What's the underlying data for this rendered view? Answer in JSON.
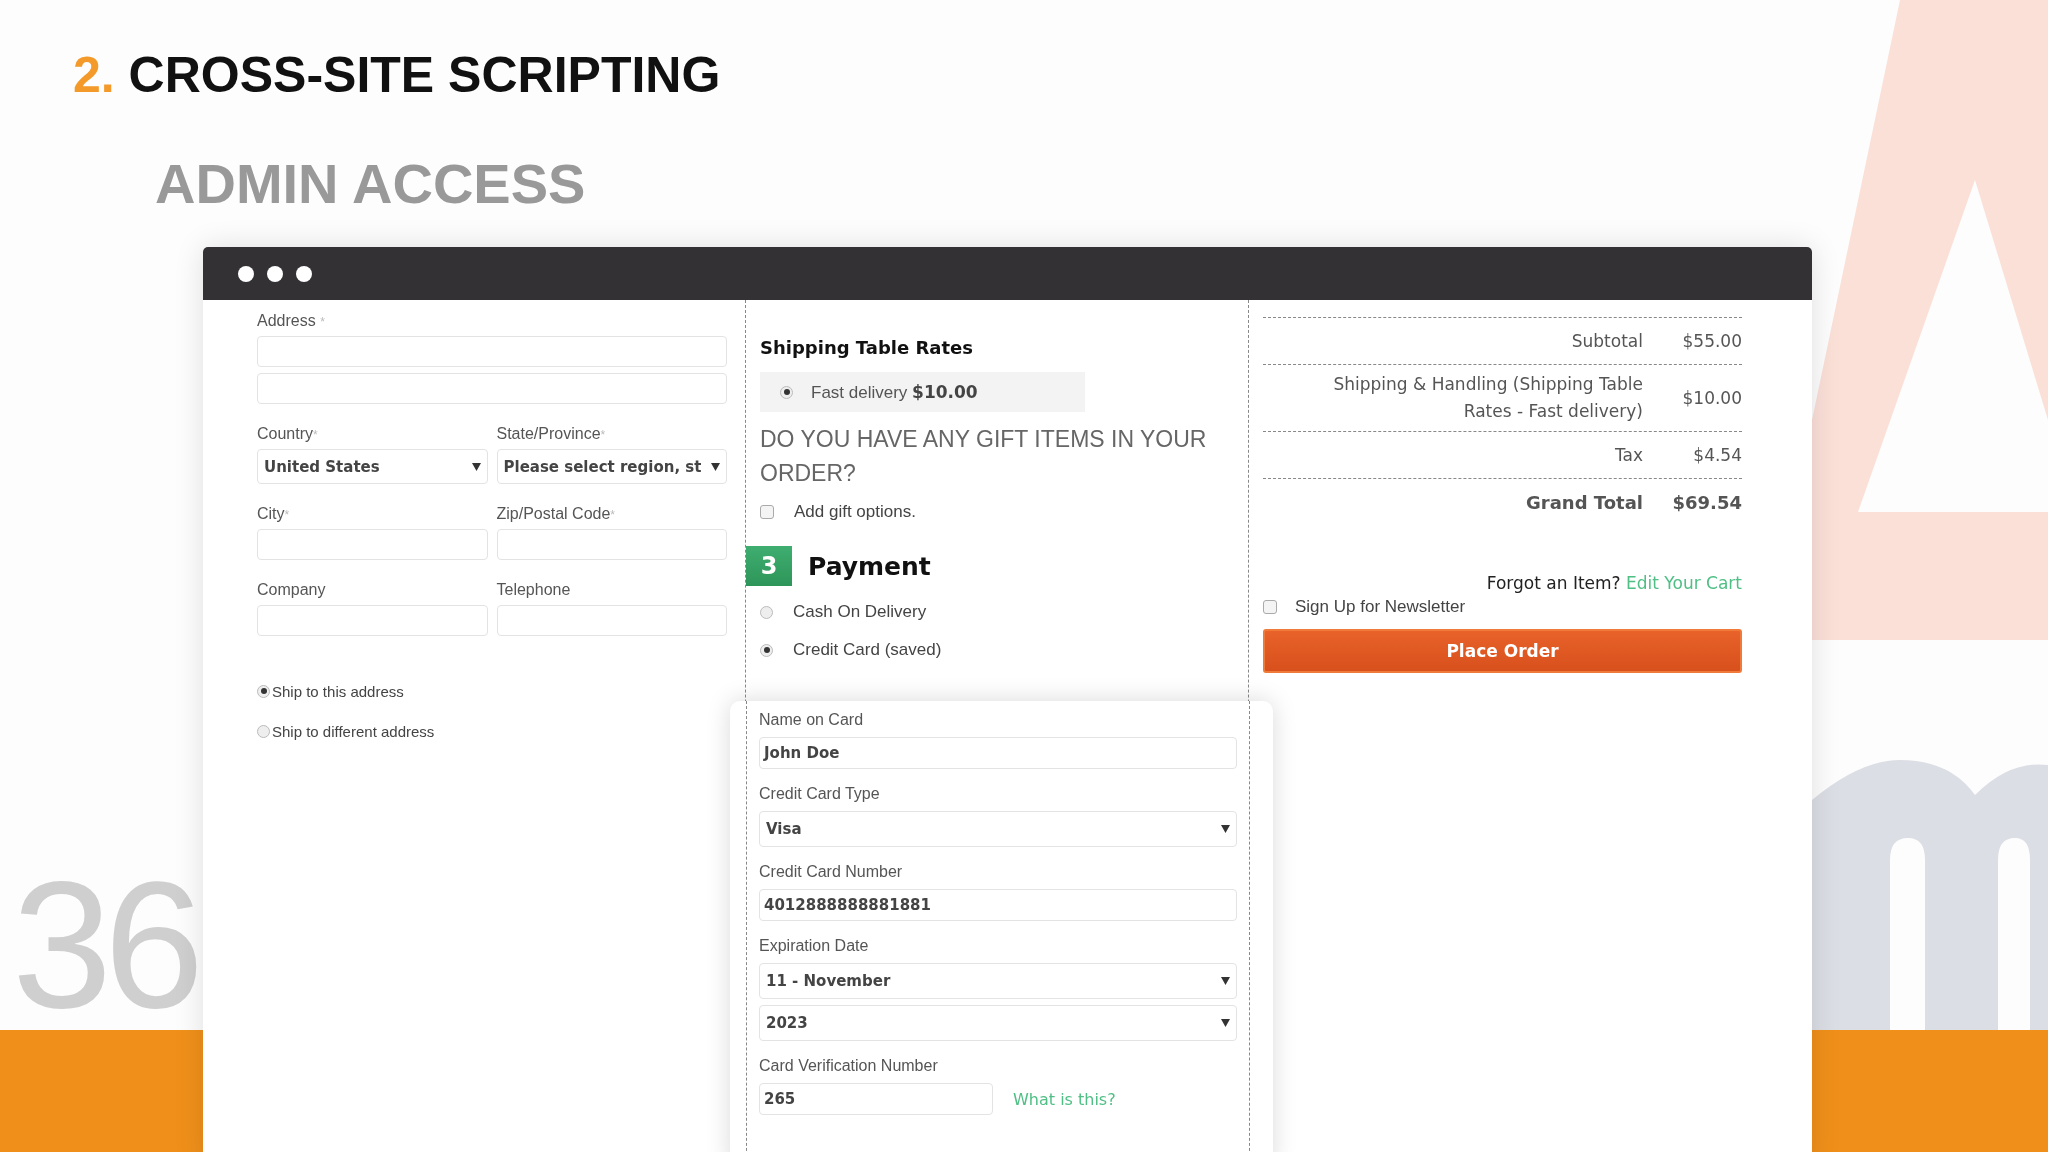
{
  "slide": {
    "number": "2.",
    "title": "CROSS-SITE SCRIPTING",
    "subtitle": "ADMIN ACCESS",
    "page_number": "36"
  },
  "address_form": {
    "address_label": "Address",
    "address_mark": "*",
    "pairs": [
      [
        {
          "label": "Country",
          "mark": "*",
          "kind": "select",
          "value": "United States"
        },
        {
          "label": "State/Province",
          "mark": "*",
          "kind": "select",
          "value": "Please select region, st"
        }
      ],
      [
        {
          "label": "City",
          "mark": "*",
          "kind": "text"
        },
        {
          "label": "Zip/Postal Code",
          "mark": "*",
          "kind": "text"
        }
      ],
      [
        {
          "label": "Company",
          "kind": "text"
        },
        {
          "label": "Telephone",
          "kind": "text"
        }
      ]
    ],
    "ship_options": [
      {
        "label": "Ship to this address",
        "selected": true
      },
      {
        "label": "Ship to different address",
        "selected": false
      }
    ]
  },
  "shipping": {
    "heading": "Shipping Table Rates",
    "option": {
      "label": "Fast delivery",
      "price": "$10.00",
      "selected": true
    }
  },
  "gift": {
    "question": "DO YOU HAVE ANY GIFT ITEMS IN YOUR ORDER?",
    "option": {
      "label": "Add gift options.",
      "checked": false
    }
  },
  "payment": {
    "step": "3",
    "heading": "Payment",
    "methods": [
      {
        "label": "Cash On Delivery",
        "selected": false
      },
      {
        "label": "Credit Card (saved)",
        "selected": true
      }
    ]
  },
  "card_form": {
    "fields": [
      {
        "label": "Name on Card",
        "kind": "text",
        "values": [
          "John Doe"
        ]
      },
      {
        "label": "Credit Card Type",
        "kind": "select",
        "values": [
          "Visa"
        ]
      },
      {
        "label": "Credit Card Number",
        "kind": "text",
        "values": [
          "4012888888881881"
        ]
      },
      {
        "label": "Expiration Date",
        "kind": "select",
        "values": [
          "11 - November",
          "2023"
        ]
      },
      {
        "label": "Card Verification Number",
        "kind": "short",
        "values": [
          "265"
        ],
        "link": "What is this?"
      }
    ]
  },
  "totals": [
    {
      "label": "Subtotal",
      "value": "$55.00",
      "kind": "normal"
    },
    {
      "label": "Shipping & Handling (Shipping Table Rates - Fast delivery)",
      "value": "$10.00",
      "kind": "normal"
    },
    {
      "label": "Tax",
      "value": "$4.54",
      "kind": "normal"
    },
    {
      "label": "Grand Total",
      "value": "$69.54",
      "kind": "total"
    }
  ],
  "cart": {
    "prompt": "Forgot an Item?",
    "link": "Edit Your Cart"
  },
  "newsletter": {
    "label": "Sign Up for Newsletter",
    "checked": false
  },
  "place_order": "Place Order"
}
